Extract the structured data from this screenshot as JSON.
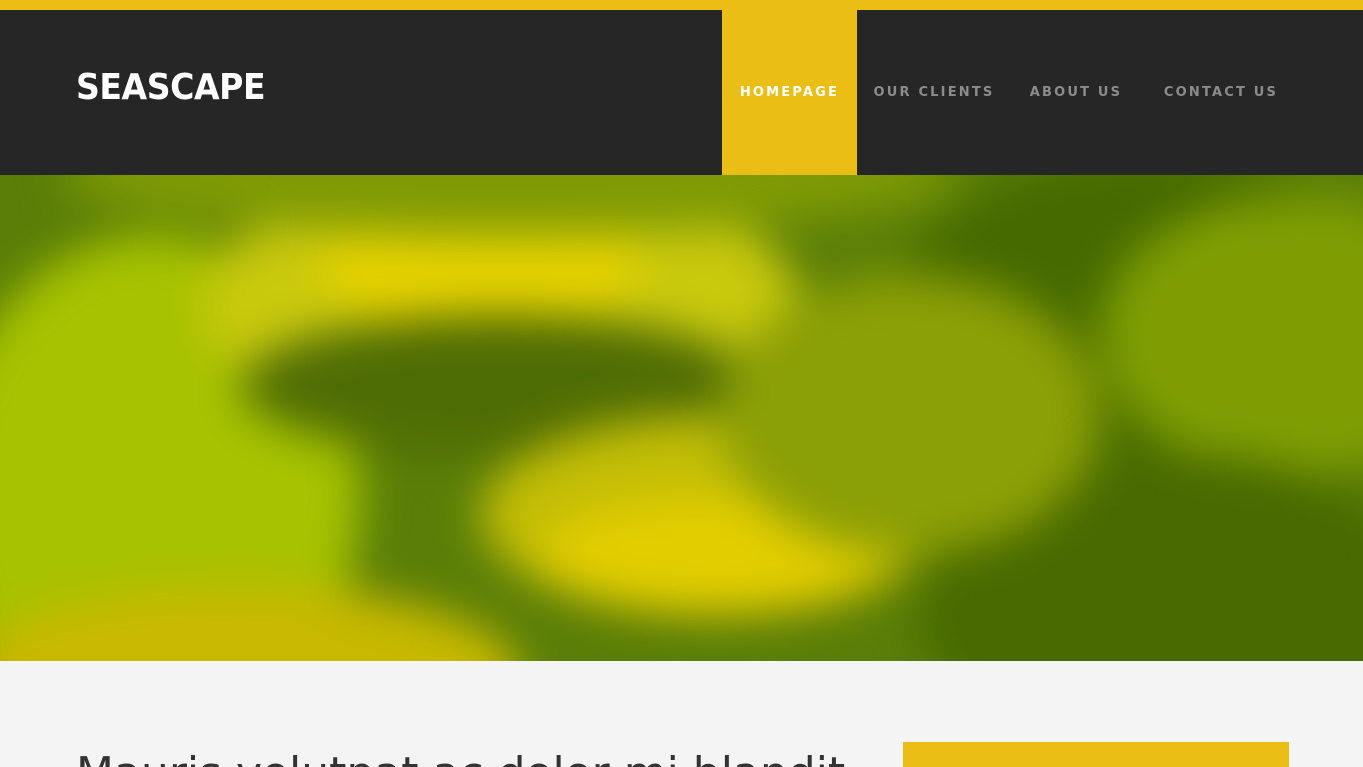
{
  "brand": {
    "name": "SEASCAPE",
    "accent_color": "#ebbe15",
    "header_bg": "#262626"
  },
  "nav": {
    "items": [
      {
        "label": "HOMEPAGE",
        "active": true
      },
      {
        "label": "OUR CLIENTS",
        "active": false
      },
      {
        "label": "ABOUT US",
        "active": false
      },
      {
        "label": "CONTACT US",
        "active": false
      }
    ]
  },
  "hero": {
    "image": "blurred-green-yellow-background"
  },
  "main": {
    "heading": "Mauris volutpat ac dolor mi blandit"
  }
}
